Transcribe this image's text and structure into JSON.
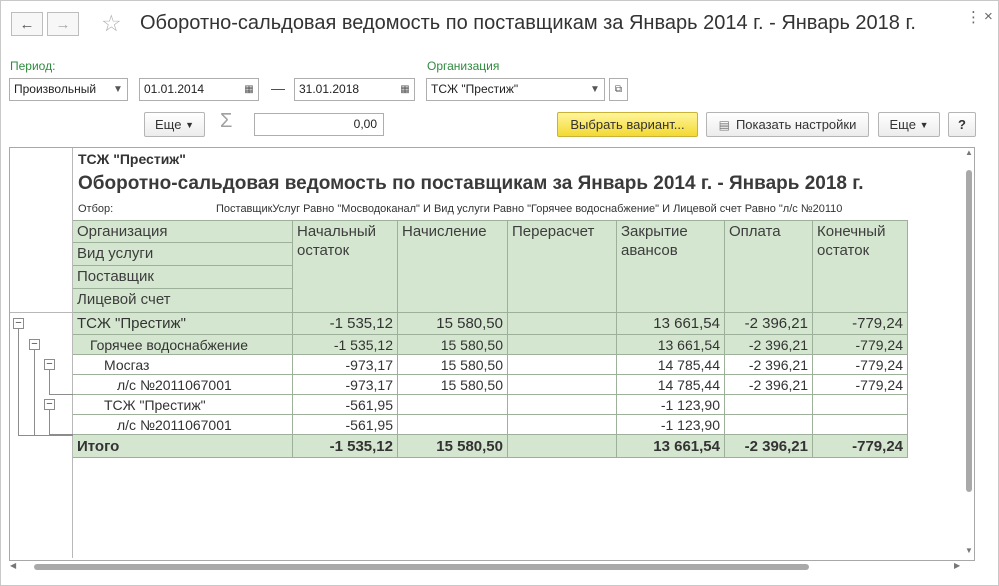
{
  "window": {
    "title": "Оборотно-сальдовая ведомость по поставщикам за Январь 2014 г. - Январь 2018 г.",
    "back_icon": "←",
    "forward_icon": "→",
    "star_icon": "☆",
    "more_icon": "⋮",
    "close_icon": "×"
  },
  "filters": {
    "period_label": "Период:",
    "period_type": "Произвольный",
    "date_from": "01.01.2014",
    "dash": "—",
    "date_to": "31.01.2018",
    "org_label": "Организация",
    "org_value": "ТСЖ \"Престиж\""
  },
  "toolbar": {
    "more_left": "Еще",
    "sigma_icon": "Σ",
    "sum_value": "0,00",
    "select_variant": "Выбрать вариант...",
    "show_settings": "Показать настройки",
    "more_right": "Еще",
    "help": "?"
  },
  "report": {
    "org_name": "ТСЖ \"Престиж\"",
    "title": "Оборотно-сальдовая ведомость по поставщикам за Январь 2014 г. - Январь 2018 г.",
    "filter_label": "Отбор:",
    "filter_text": "ПоставщикУслуг Равно \"Мосводоканал\" И Вид услуги Равно \"Горячее водоснабжение\" И Лицевой счет Равно \"л/с №20110",
    "left_headers": [
      "Организация",
      "Вид услуги",
      "Поставщик",
      "Лицевой счет"
    ],
    "columns": [
      "Начальный остаток",
      "Начисление",
      "Перерасчет",
      "Закрытие авансов",
      "Оплата",
      "Конечный остаток"
    ],
    "rows": [
      {
        "name": "ТСЖ \"Престиж\"",
        "values": [
          "-1 535,12",
          "15 580,50",
          "",
          "13 661,54",
          "-2 396,21",
          "-779,24"
        ]
      },
      {
        "name": "Горячее водоснабжение",
        "values": [
          "-1 535,12",
          "15 580,50",
          "",
          "13 661,54",
          "-2 396,21",
          "-779,24"
        ]
      },
      {
        "name": "Мосгаз",
        "values": [
          "-973,17",
          "15 580,50",
          "",
          "14 785,44",
          "-2 396,21",
          "-779,24"
        ]
      },
      {
        "name": "л/с №2011067001",
        "values": [
          "-973,17",
          "15 580,50",
          "",
          "14 785,44",
          "-2 396,21",
          "-779,24"
        ]
      },
      {
        "name": "ТСЖ \"Престиж\"",
        "values": [
          "-561,95",
          "",
          "",
          "-1 123,90",
          "",
          ""
        ]
      },
      {
        "name": "л/с №2011067001",
        "values": [
          "-561,95",
          "",
          "",
          "-1 123,90",
          "",
          ""
        ]
      }
    ],
    "total": {
      "name": "Итого",
      "values": [
        "-1 535,12",
        "15 580,50",
        "",
        "13 661,54",
        "-2 396,21",
        "-779,24"
      ]
    },
    "collapse_icon": "−"
  }
}
